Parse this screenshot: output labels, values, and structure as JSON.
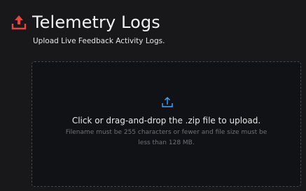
{
  "header": {
    "title": "Telemetry Logs",
    "subtitle": "Upload Live Feedback Activity Logs.",
    "icon": "upload-icon",
    "icon_color": "#e8453c"
  },
  "dropzone": {
    "icon": "upload-arrow-icon",
    "icon_color": "#3ea8ff",
    "primary_text": "Click or drag-and-drop the .zip file to upload.",
    "secondary_text": "Filename must be 255 characters or fewer and file size must be less than 128 MB."
  },
  "colors": {
    "background": "#18181b",
    "dropzone_background": "#111215",
    "dropzone_border": "#44464d"
  }
}
